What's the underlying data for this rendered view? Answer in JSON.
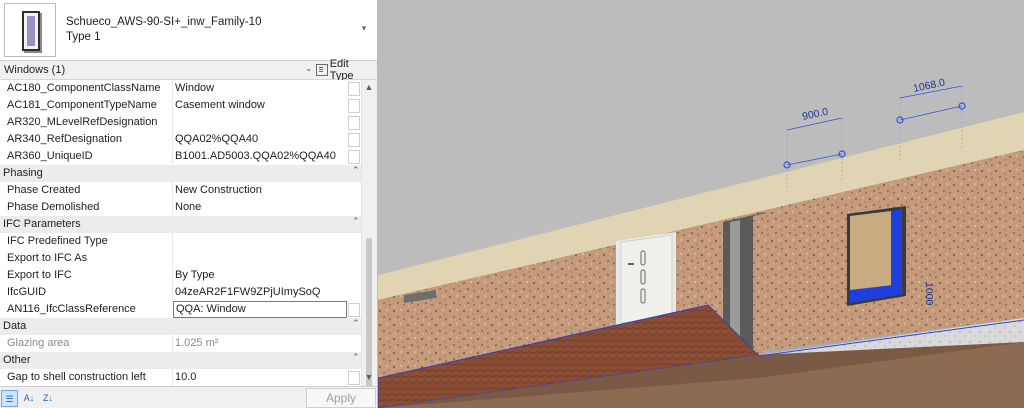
{
  "type_selector": {
    "family": "Schueco_AWS-90-SI+_inw_Family-10",
    "type": "Type 1"
  },
  "filter": {
    "label": "Windows (1)",
    "edit_type_label": "Edit Type"
  },
  "rows": {
    "ac180": {
      "name": "AC180_ComponentClassName",
      "value": "Window"
    },
    "ac181": {
      "name": "AC181_ComponentTypeName",
      "value": "Casement window"
    },
    "ar320": {
      "name": "AR320_MLevelRefDesignation",
      "value": ""
    },
    "ar340": {
      "name": "AR340_RefDesignation",
      "value": "QQA02%QQA40"
    },
    "ar360": {
      "name": "AR360_UniqueID",
      "value": "B1001.AD5003.QQA02%QQA40"
    },
    "phase_created": {
      "name": "Phase Created",
      "value": "New Construction"
    },
    "phase_demolished": {
      "name": "Phase Demolished",
      "value": "None"
    },
    "ifc_predefined": {
      "name": "IFC Predefined Type",
      "value": ""
    },
    "export_ifc_as": {
      "name": "Export to IFC As",
      "value": ""
    },
    "export_ifc": {
      "name": "Export to IFC",
      "value": "By Type"
    },
    "ifc_guid": {
      "name": "IfcGUID",
      "value": "04zeAR2F1FW9ZPjUImySoQ"
    },
    "an116": {
      "name": "AN116_IfcClassReference",
      "value": "QQA: Window"
    },
    "glazing": {
      "name": "Glazing area",
      "value": "1.025 m²"
    },
    "gap_left": {
      "name": "Gap to shell construction left",
      "value": "10.0"
    }
  },
  "groups": {
    "phasing": "Phasing",
    "ifc": "IFC Parameters",
    "data": "Data",
    "other": "Other"
  },
  "bottom": {
    "apply_label": "Apply"
  },
  "viewport": {
    "dim_900": "900.0",
    "dim_1068": "1068.0",
    "dim_side": "1000"
  }
}
